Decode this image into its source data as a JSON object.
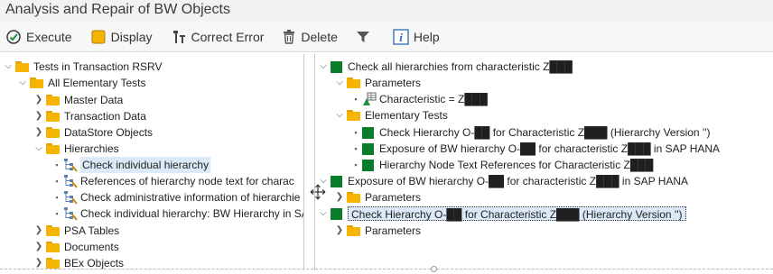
{
  "window": {
    "title": "Analysis and Repair of BW Objects"
  },
  "toolbar": {
    "execute": "Execute",
    "display": "Display",
    "correct_error": "Correct Error",
    "delete": "Delete",
    "help": "Help"
  },
  "left_tree": {
    "root": "Tests in Transaction RSRV",
    "all_elementary": "All Elementary Tests",
    "master_data": "Master Data",
    "transaction_data": "Transaction Data",
    "datastore_objects": "DataStore Objects",
    "hierarchies": "Hierarchies",
    "check_individual_hierarchy": "Check individual hierarchy",
    "references_node_text": "References of hierarchy node text for charac",
    "check_admin_info": "Check administrative information of hierarchie",
    "check_bw_hierarchy_sap": "Check individual hierarchy: BW Hierarchy in SA",
    "psa_tables": "PSA Tables",
    "documents": "Documents",
    "bex_objects": "BEx Objects"
  },
  "right_tree": {
    "check_all": "Check all hierarchies from characteristic Z███",
    "parameters_1": "Parameters",
    "characteristic": "Characteristic = Z███",
    "elementary_tests": "Elementary Tests",
    "check_hierarchy_1": "Check Hierarchy O-██ for Characteristic Z███ (Hierarchy Version '')",
    "exposure_1": "Exposure of BW hierarchy O-██ for characteristic Z███ in SAP HANA",
    "node_text_refs": "Hierarchy Node Text References for Characteristic Z███",
    "exposure_2": "Exposure of BW hierarchy O-██ for characteristic Z███ in SAP HANA",
    "parameters_2": "Parameters",
    "check_hierarchy_2": "Check Hierarchy O-██ for Characteristic Z███ (Hierarchy Version '')",
    "parameters_3": "Parameters"
  },
  "icons": {
    "execute": "execute-icon",
    "display": "display-icon",
    "correct_error": "correct-error-icon",
    "delete": "trash-icon",
    "filter": "filter-icon",
    "help": "info-icon"
  },
  "colors": {
    "folder": "#f5b400",
    "status_green": "#0a7d2a",
    "selection": "#dbe9f8"
  }
}
